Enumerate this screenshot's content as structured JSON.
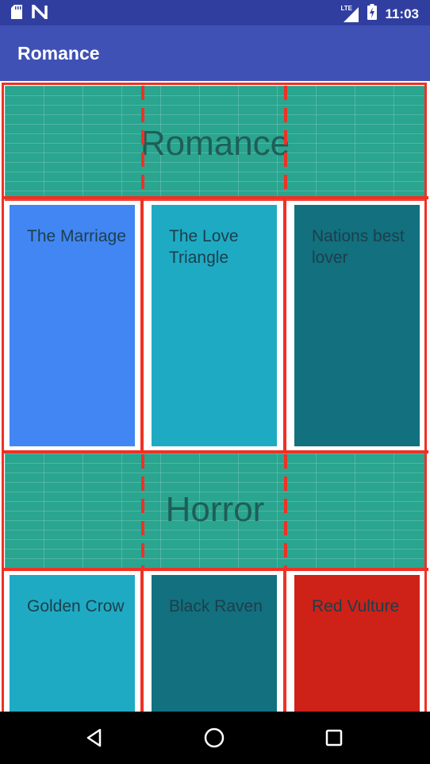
{
  "status_bar": {
    "time": "11:03",
    "network_label": "LTE",
    "icons": [
      "sd-card-icon",
      "n-notification-icon",
      "signal-icon",
      "battery-charging-icon"
    ]
  },
  "app_bar": {
    "title": "Romance"
  },
  "sections": [
    {
      "heading": "Romance",
      "books": [
        {
          "title": "The Marriage",
          "color": "#4286f4"
        },
        {
          "title": "The Love Triangle",
          "color": "#1faac4"
        },
        {
          "title": "Nations best lover",
          "color": "#12707f"
        }
      ]
    },
    {
      "heading": "Horror",
      "books": [
        {
          "title": "Golden Crow",
          "color": "#1faac4"
        },
        {
          "title": "Black Raven",
          "color": "#12707f"
        },
        {
          "title": "Red Vulture",
          "color": "#ce2117"
        }
      ]
    }
  ],
  "colors": {
    "status_bar": "#303f9f",
    "app_bar": "#3f51b5",
    "header_band": "#2aa58f",
    "guide_lines": "#ef3124"
  },
  "nav_bar": {
    "icons": [
      "back-icon",
      "home-icon",
      "recents-icon"
    ]
  }
}
